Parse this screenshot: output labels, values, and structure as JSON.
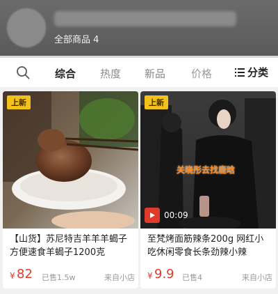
{
  "header": {
    "subtitle": "全部商品 4"
  },
  "tabs": [
    {
      "label": "综合",
      "active": true
    },
    {
      "label": "热度",
      "active": false
    },
    {
      "label": "新品",
      "active": false
    },
    {
      "label": "价格",
      "active": false
    }
  ],
  "filter": {
    "label": "分类",
    "icon": "list-icon"
  },
  "search": {
    "icon": "search-icon"
  },
  "colors": {
    "price": "#e03a2b",
    "badge": "#f2c21a",
    "header": "#5f5f5f"
  },
  "products": [
    {
      "badge": "上新",
      "title": "【山货】苏尼特吉羊羊羊蝎子 方便速食羊蝎子1200克",
      "price_symbol": "¥",
      "price": "82",
      "sold": "已售1.5w",
      "origin": "来自小店"
    },
    {
      "badge": "上新",
      "title": "至梵烤面筋辣条200g 网红小吃休闲零食长条劲辣小辣",
      "price_symbol": "¥",
      "price": "9.9",
      "sold": "已售4",
      "origin": "来自小店",
      "video_caption": "关晓彤去找鹿晗",
      "duration": "00:09"
    }
  ]
}
